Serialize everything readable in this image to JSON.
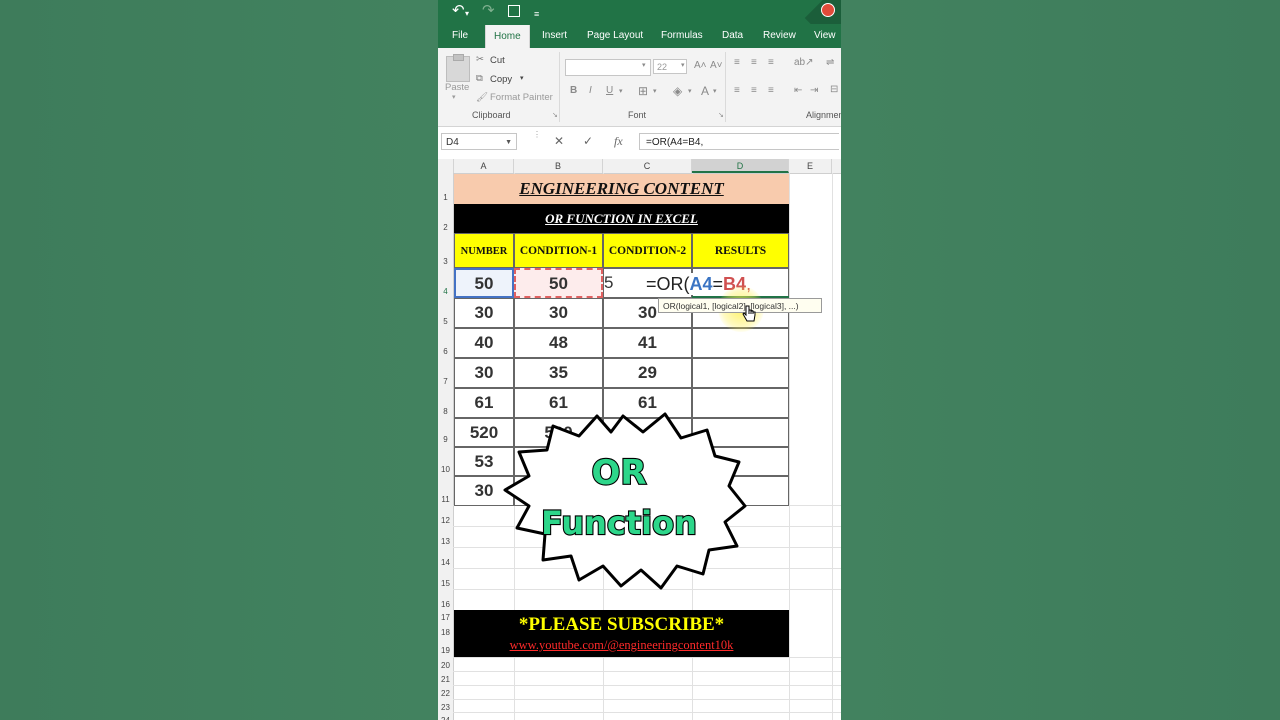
{
  "qat": {
    "undo_icon": "undo-icon",
    "redo_icon": "redo-icon",
    "save_icon": "save-icon",
    "customize_icon": "customize-qat-icon"
  },
  "tabs": [
    "File",
    "Home",
    "Insert",
    "Page Layout",
    "Formulas",
    "Data",
    "Review",
    "View"
  ],
  "ribbon": {
    "clipboard": {
      "paste": "Paste",
      "cut": "Cut",
      "copy": "Copy",
      "format_painter": "Format Painter",
      "group_label": "Clipboard"
    },
    "font": {
      "size": "22",
      "group_label": "Font",
      "bold": "B",
      "italic": "I",
      "underline": "U"
    },
    "alignment": {
      "group_label": "Alignmen"
    }
  },
  "formula_bar": {
    "name_box": "D4",
    "cancel": "✕",
    "enter": "✓",
    "fx": "fx",
    "formula": "=OR(A4=B4,"
  },
  "columns": [
    "A",
    "B",
    "C",
    "D",
    "E"
  ],
  "rows": [
    "1",
    "2",
    "3",
    "4",
    "5",
    "6",
    "7",
    "8",
    "9",
    "10",
    "11",
    "12",
    "13",
    "14",
    "15",
    "16",
    "17",
    "18",
    "19",
    "20",
    "21",
    "22",
    "23",
    "24"
  ],
  "sheet": {
    "title": "ENGINEERING CONTENT",
    "subtitle": "OR FUNCTION IN EXCEL",
    "headers": [
      "NUMBER",
      "CONDITION-1",
      "CONDITION-2",
      "RESULTS"
    ],
    "data": [
      [
        "50",
        "50",
        "5",
        ""
      ],
      [
        "30",
        "30",
        "30",
        ""
      ],
      [
        "40",
        "48",
        "41",
        ""
      ],
      [
        "30",
        "35",
        "29",
        ""
      ],
      [
        "61",
        "61",
        "61",
        ""
      ],
      [
        "520",
        "520",
        "",
        ""
      ],
      [
        "53",
        "",
        "",
        ""
      ],
      [
        "30",
        "",
        "",
        ""
      ]
    ]
  },
  "editing": {
    "prefix": "=OR(",
    "ref1": "A4",
    "eq": "=",
    "ref2": "B4",
    "suffix": ","
  },
  "tooltip": "OR(logical1, [logical2], [logical3], ...)",
  "burst": {
    "line1": "OR",
    "line2": "Function"
  },
  "subscribe": {
    "line1": "*PLEASE SUBSCRIBE*",
    "line2": "www.youtube.com/@engineeringcontent10k"
  }
}
